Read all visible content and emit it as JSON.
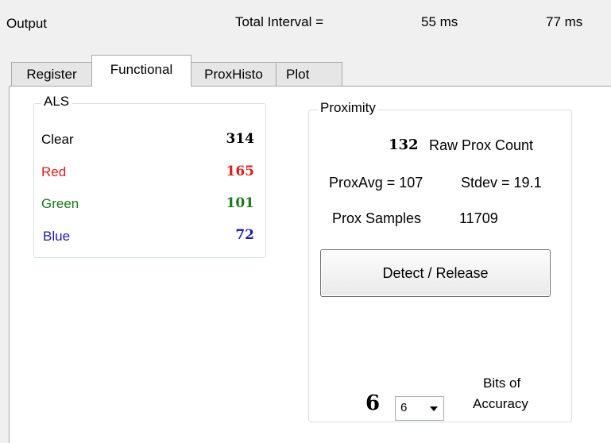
{
  "header": {
    "output_label": "Output",
    "interval_label": "Total Interval =",
    "interval_value_1": "55 ms",
    "interval_value_2": "77 ms"
  },
  "tabs": [
    {
      "label": "Register",
      "active": false
    },
    {
      "label": "Functional",
      "active": true
    },
    {
      "label": "ProxHisto",
      "active": false
    },
    {
      "label": "Plot",
      "active": false
    }
  ],
  "als": {
    "title": "ALS",
    "rows": [
      {
        "label": "Clear",
        "value": "314",
        "color": "#000000"
      },
      {
        "label": "Red",
        "value": "165",
        "color": "#e31b1b"
      },
      {
        "label": "Green",
        "value": "101",
        "color": "#1a7a1a"
      },
      {
        "label": "Blue",
        "value": "72",
        "color": "#1a1ab8"
      }
    ]
  },
  "proximity": {
    "title": "Proximity",
    "raw_count_value": "132",
    "raw_count_label": "Raw Prox Count",
    "prox_avg": "ProxAvg = 107",
    "stdev": "Stdev = 19.1",
    "samples_label": "Prox Samples",
    "samples_value": "11709",
    "detect_button_label": "Detect / Release",
    "bits_display": "6",
    "bits_selected": "6",
    "bits_label_line1": "Bits of",
    "bits_label_line2": "Accuracy"
  }
}
